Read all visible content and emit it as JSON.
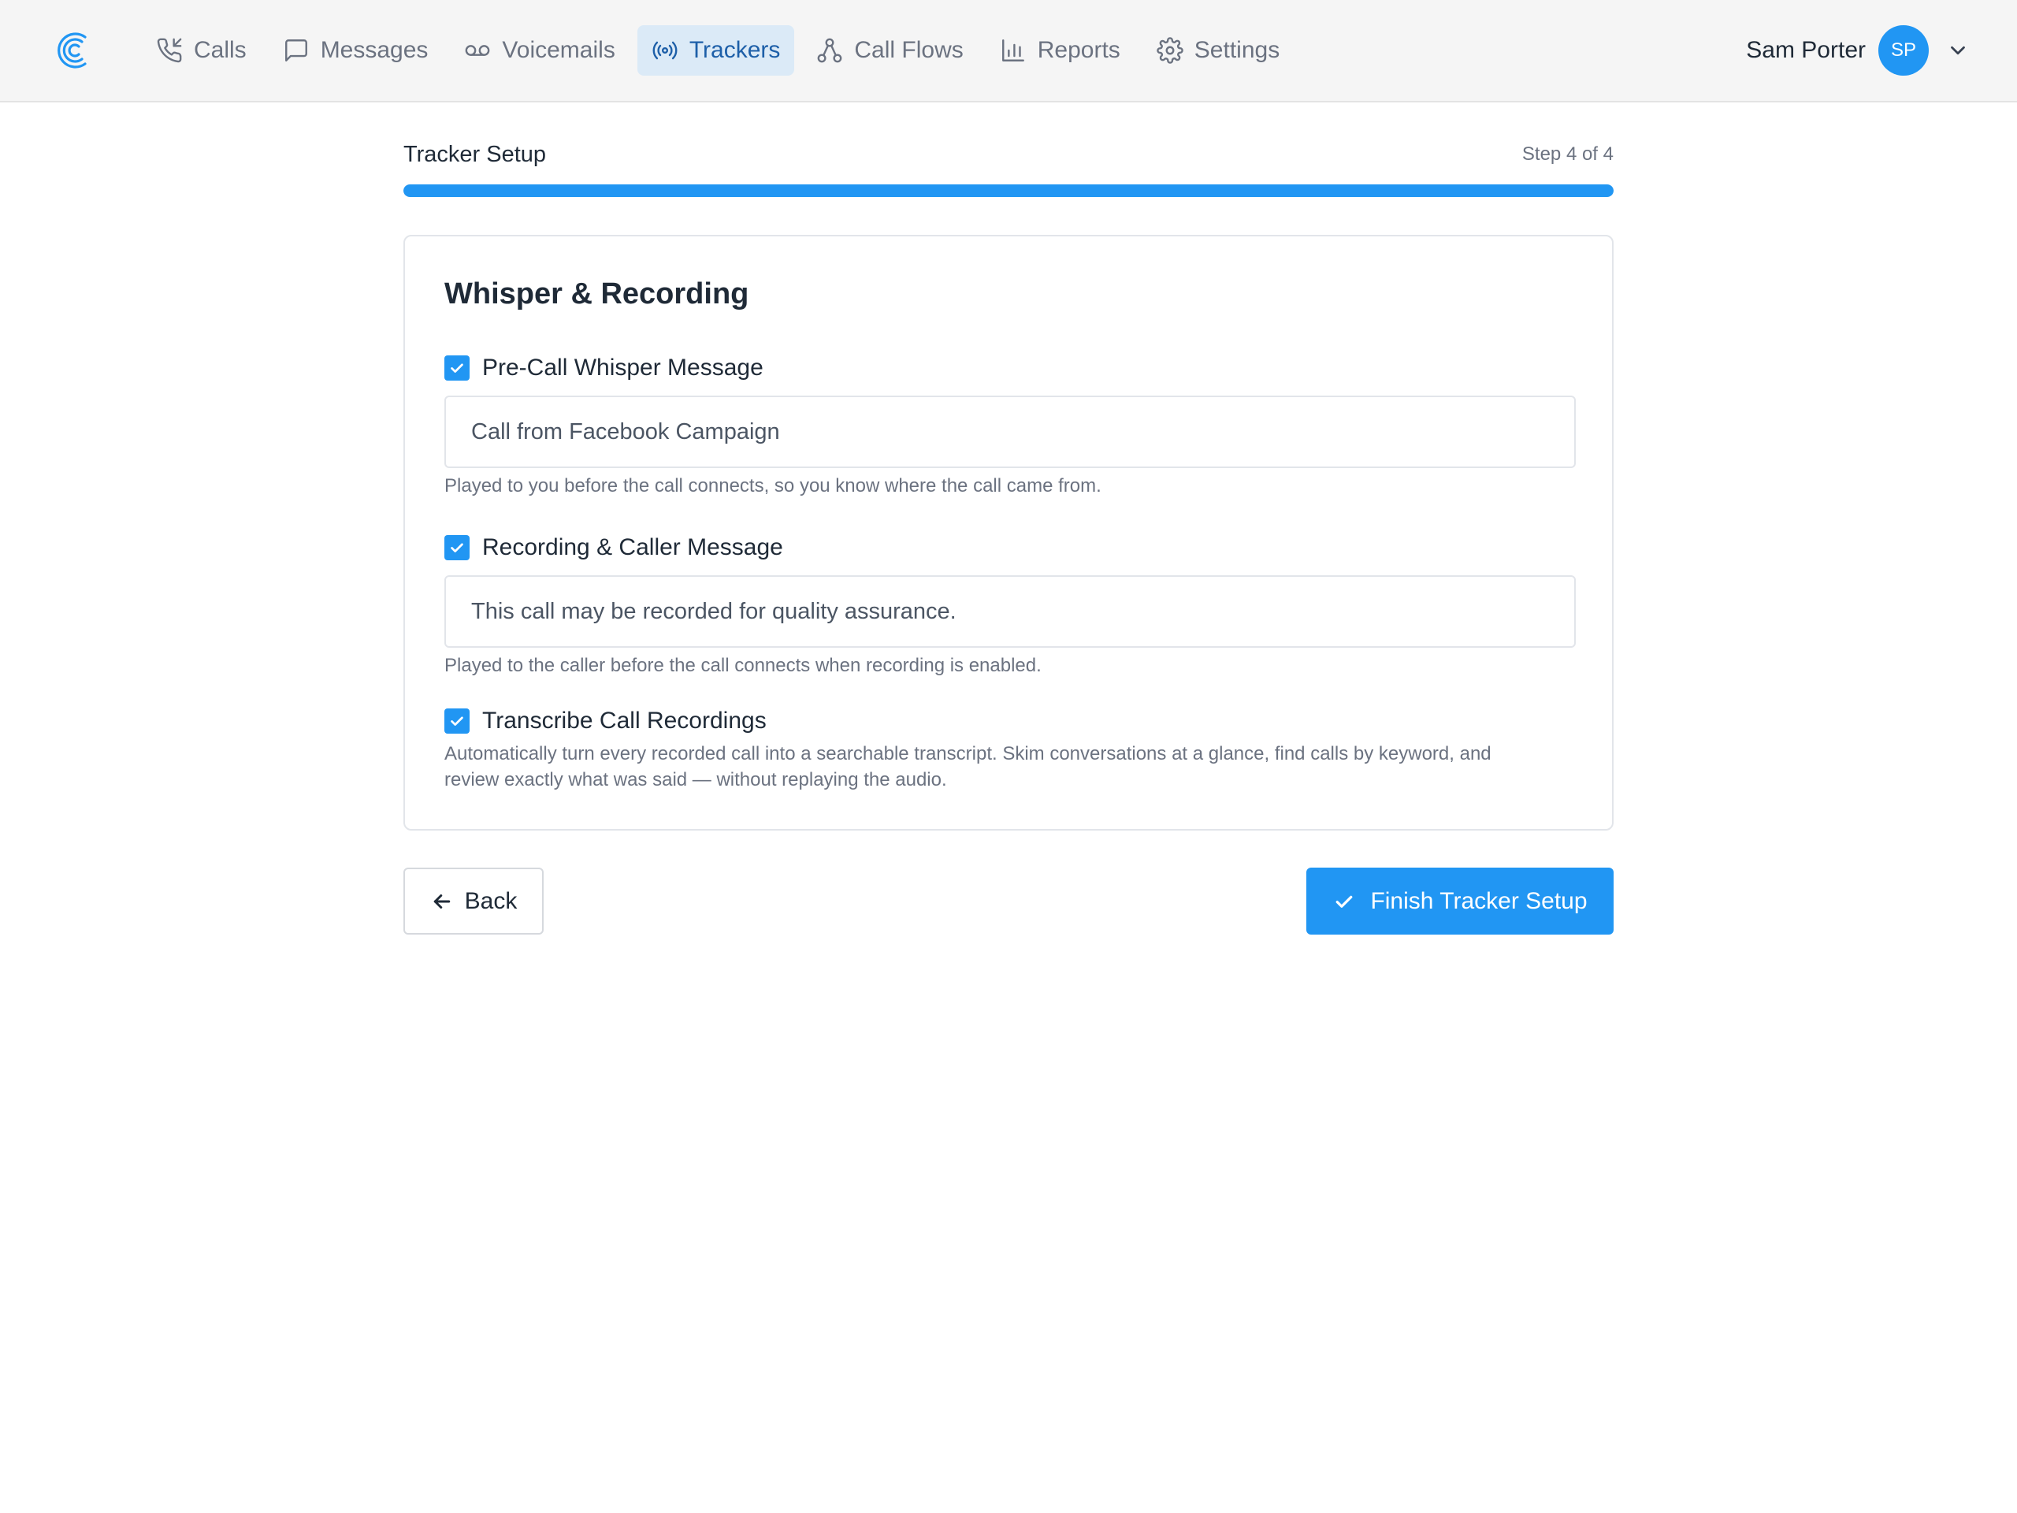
{
  "colors": {
    "accent": "#2196f3",
    "nav_active_bg": "#dbeaf7",
    "nav_active_text": "#1d5fa8"
  },
  "nav": {
    "items": [
      {
        "label": "Calls",
        "icon": "phone-incoming-icon",
        "active": false
      },
      {
        "label": "Messages",
        "icon": "message-square-icon",
        "active": false
      },
      {
        "label": "Voicemails",
        "icon": "voicemail-icon",
        "active": false
      },
      {
        "label": "Trackers",
        "icon": "broadcast-icon",
        "active": true
      },
      {
        "label": "Call Flows",
        "icon": "flow-nodes-icon",
        "active": false
      },
      {
        "label": "Reports",
        "icon": "bar-chart-icon",
        "active": false
      },
      {
        "label": "Settings",
        "icon": "gear-icon",
        "active": false
      }
    ]
  },
  "user": {
    "name": "Sam Porter",
    "initials": "SP"
  },
  "setup": {
    "title": "Tracker Setup",
    "step_text": "Step 4 of 4",
    "progress": 1.0
  },
  "card": {
    "title": "Whisper & Recording",
    "whisper": {
      "label": "Pre-Call Whisper Message",
      "checked": true,
      "value": "Call from Facebook Campaign",
      "help": "Played to you before the call connects, so you know where the call came from."
    },
    "recording": {
      "label": "Recording & Caller Message",
      "checked": true,
      "value": "This call may be recorded for quality assurance.",
      "help": "Played to the caller before the call connects when recording is enabled."
    },
    "transcribe": {
      "label": "Transcribe Call Recordings",
      "checked": true,
      "help_line1": "Automatically turn every recorded call into a searchable transcript. Skim conversations at a glance, find calls by keyword, and",
      "help_line2": "review exactly what was said — without replaying the audio."
    }
  },
  "actions": {
    "back_label": "Back",
    "finish_label": "Finish Tracker Setup"
  }
}
